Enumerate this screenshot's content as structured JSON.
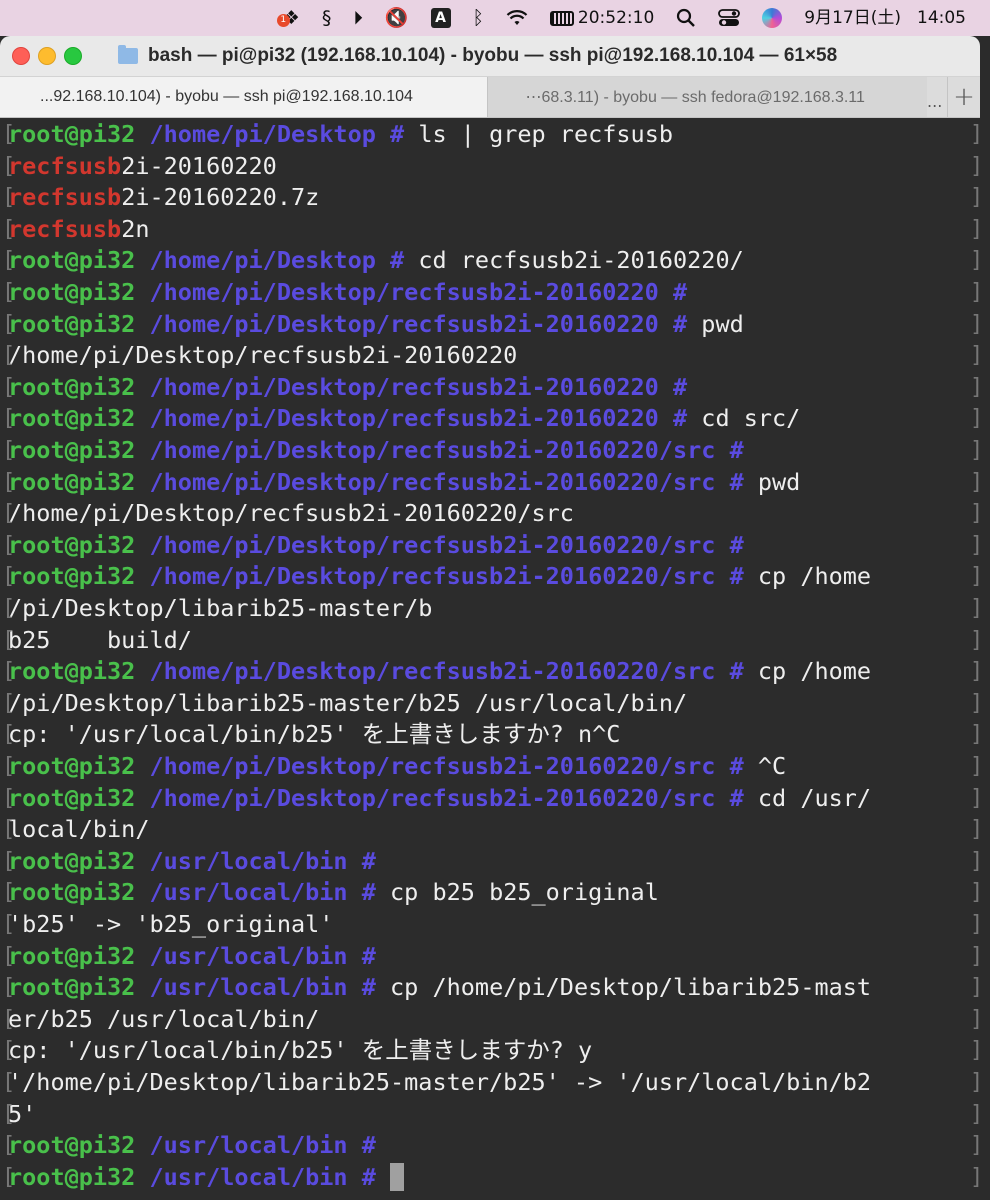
{
  "menubar": {
    "badge_count": "1",
    "input_source": "A",
    "cpu_time": "20:52:10",
    "date": "9月17日(土)",
    "time": "14:05"
  },
  "window": {
    "title": "bash — pi@pi32 (192.168.10.104) - byobu — ssh pi@192.168.10.104 — 61×58",
    "tabs": [
      {
        "label": "...92.168.10.104) - byobu — ssh pi@192.168.10.104"
      },
      {
        "label": "⋯68.3.11) - byobu — ssh fedora@192.168.3.11"
      }
    ],
    "more_label": "...",
    "add_label": "+"
  },
  "terminal": {
    "user": "root@pi32",
    "lines": [
      {
        "kind": "prompt",
        "path": "/home/pi/Desktop",
        "cmd": "ls | grep recfsusb"
      },
      {
        "kind": "match",
        "match": "recfsusb",
        "rest": "2i-20160220"
      },
      {
        "kind": "match",
        "match": "recfsusb",
        "rest": "2i-20160220.7z"
      },
      {
        "kind": "match",
        "match": "recfsusb",
        "rest": "2n"
      },
      {
        "kind": "prompt",
        "path": "/home/pi/Desktop",
        "cmd": "cd recfsusb2i-20160220/"
      },
      {
        "kind": "prompt",
        "path": "/home/pi/Desktop/recfsusb2i-20160220",
        "cmd": ""
      },
      {
        "kind": "prompt",
        "path": "/home/pi/Desktop/recfsusb2i-20160220",
        "cmd": "pwd"
      },
      {
        "kind": "text",
        "text": "/home/pi/Desktop/recfsusb2i-20160220"
      },
      {
        "kind": "prompt",
        "path": "/home/pi/Desktop/recfsusb2i-20160220",
        "cmd": ""
      },
      {
        "kind": "prompt",
        "path": "/home/pi/Desktop/recfsusb2i-20160220",
        "cmd": "cd src/"
      },
      {
        "kind": "prompt",
        "path": "/home/pi/Desktop/recfsusb2i-20160220/src",
        "cmd": ""
      },
      {
        "kind": "prompt",
        "path": "/home/pi/Desktop/recfsusb2i-20160220/src",
        "cmd": "pwd"
      },
      {
        "kind": "text",
        "text": "/home/pi/Desktop/recfsusb2i-20160220/src"
      },
      {
        "kind": "prompt",
        "path": "/home/pi/Desktop/recfsusb2i-20160220/src",
        "cmd": ""
      },
      {
        "kind": "prompt",
        "path": "/home/pi/Desktop/recfsusb2i-20160220/src",
        "cmd": "cp /home"
      },
      {
        "kind": "text",
        "text": "/pi/Desktop/libarib25-master/b"
      },
      {
        "kind": "text",
        "text": "b25    build/"
      },
      {
        "kind": "prompt",
        "path": "/home/pi/Desktop/recfsusb2i-20160220/src",
        "cmd": "cp /home"
      },
      {
        "kind": "text",
        "text": "/pi/Desktop/libarib25-master/b25 /usr/local/bin/"
      },
      {
        "kind": "text",
        "text": "cp: '/usr/local/bin/b25' を上書きしますか? n^C"
      },
      {
        "kind": "prompt",
        "path": "/home/pi/Desktop/recfsusb2i-20160220/src",
        "cmd": "^C"
      },
      {
        "kind": "prompt",
        "path": "/home/pi/Desktop/recfsusb2i-20160220/src",
        "cmd": "cd /usr/"
      },
      {
        "kind": "text",
        "text": "local/bin/"
      },
      {
        "kind": "prompt",
        "path": "/usr/local/bin",
        "cmd": ""
      },
      {
        "kind": "prompt",
        "path": "/usr/local/bin",
        "cmd": "cp b25 b25_original"
      },
      {
        "kind": "text",
        "text": "'b25' -> 'b25_original'"
      },
      {
        "kind": "prompt",
        "path": "/usr/local/bin",
        "cmd": ""
      },
      {
        "kind": "prompt",
        "path": "/usr/local/bin",
        "cmd": "cp /home/pi/Desktop/libarib25-mast"
      },
      {
        "kind": "text",
        "text": "er/b25 /usr/local/bin/"
      },
      {
        "kind": "text",
        "text": "cp: '/usr/local/bin/b25' を上書きしますか? y"
      },
      {
        "kind": "text",
        "text": "'/home/pi/Desktop/libarib25-master/b25' -> '/usr/local/bin/b2"
      },
      {
        "kind": "text",
        "text": "5'"
      },
      {
        "kind": "prompt",
        "path": "/usr/local/bin",
        "cmd": ""
      },
      {
        "kind": "prompt",
        "path": "/usr/local/bin",
        "cmd": "",
        "cursor": true
      }
    ]
  }
}
